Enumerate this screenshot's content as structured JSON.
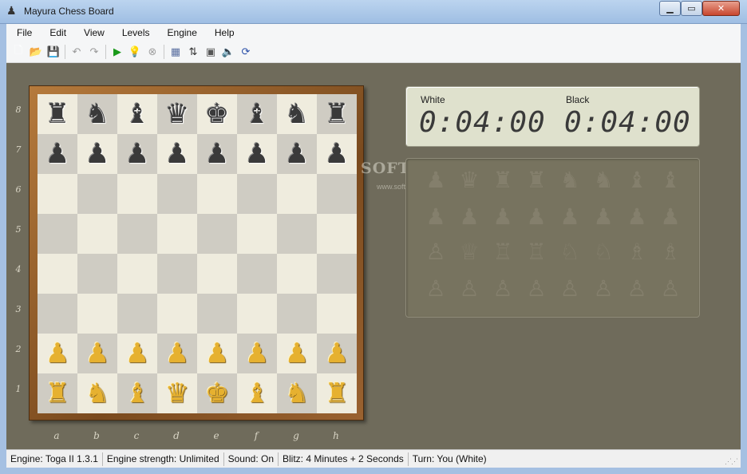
{
  "window": {
    "title": "Mayura Chess Board",
    "app_icon": "pawn-icon",
    "controls": {
      "minimize": "minimize-icon",
      "maximize": "maximize-icon",
      "close": "close-icon"
    }
  },
  "menu": [
    "File",
    "Edit",
    "View",
    "Levels",
    "Engine",
    "Help"
  ],
  "toolbar": {
    "buttons": [
      {
        "name": "new-game",
        "icon": "new-document-icon",
        "glyph": "🗋",
        "color": "#ffffff"
      },
      {
        "name": "open-game",
        "icon": "folder-open-icon",
        "glyph": "📂",
        "color": "#d9a520"
      },
      {
        "name": "save-game",
        "icon": "save-icon",
        "glyph": "💾",
        "color": "#2a4fa8"
      },
      {
        "name": "undo",
        "icon": "undo-icon",
        "glyph": "↶",
        "color": "#9a9a9a"
      },
      {
        "name": "redo",
        "icon": "redo-icon",
        "glyph": "↷",
        "color": "#9a9a9a"
      },
      {
        "name": "play",
        "icon": "play-icon",
        "glyph": "▶",
        "color": "#1a9a1a"
      },
      {
        "name": "hint",
        "icon": "lightbulb-icon",
        "glyph": "💡",
        "color": "#e0c020"
      },
      {
        "name": "stop",
        "icon": "stop-icon",
        "glyph": "⊗",
        "color": "#a0a0a0"
      },
      {
        "name": "properties",
        "icon": "settings-icon",
        "glyph": "▦",
        "color": "#5a6fa0"
      },
      {
        "name": "flip-board",
        "icon": "flip-board-icon",
        "glyph": "⇅",
        "color": "#333333"
      },
      {
        "name": "setup-position",
        "icon": "board-setup-icon",
        "glyph": "▣",
        "color": "#555555"
      },
      {
        "name": "sound",
        "icon": "speaker-icon",
        "glyph": "🔈",
        "color": "#c08020"
      },
      {
        "name": "switch-sides",
        "icon": "switch-sides-icon",
        "glyph": "⟳",
        "color": "#2a4fa8"
      }
    ]
  },
  "board": {
    "ranks": [
      "8",
      "7",
      "6",
      "5",
      "4",
      "3",
      "2",
      "1"
    ],
    "files": [
      "a",
      "b",
      "c",
      "d",
      "e",
      "f",
      "g",
      "h"
    ],
    "position": [
      [
        "bR",
        "bN",
        "bB",
        "bQ",
        "bK",
        "bB",
        "bN",
        "bR"
      ],
      [
        "bP",
        "bP",
        "bP",
        "bP",
        "bP",
        "bP",
        "bP",
        "bP"
      ],
      [
        "",
        "",
        "",
        "",
        "",
        "",
        "",
        ""
      ],
      [
        "",
        "",
        "",
        "",
        "",
        "",
        "",
        ""
      ],
      [
        "",
        "",
        "",
        "",
        "",
        "",
        "",
        ""
      ],
      [
        "",
        "",
        "",
        "",
        "",
        "",
        "",
        ""
      ],
      [
        "wP",
        "wP",
        "wP",
        "wP",
        "wP",
        "wP",
        "wP",
        "wP"
      ],
      [
        "wR",
        "wN",
        "wB",
        "wQ",
        "wK",
        "wB",
        "wN",
        "wR"
      ]
    ]
  },
  "clock": {
    "white_label": "White",
    "white_time": "0:04:00",
    "black_label": "Black",
    "black_time": "0:04:00"
  },
  "watermark": {
    "text": "SOFTPEDIA",
    "url": "www.softpedia.com"
  },
  "status": {
    "engine": "Engine: Toga II 1.3.1",
    "strength": "Engine strength: Unlimited",
    "sound": "Sound: On",
    "blitz": "Blitz: 4 Minutes + 2 Seconds",
    "turn": "Turn: You (White)"
  }
}
